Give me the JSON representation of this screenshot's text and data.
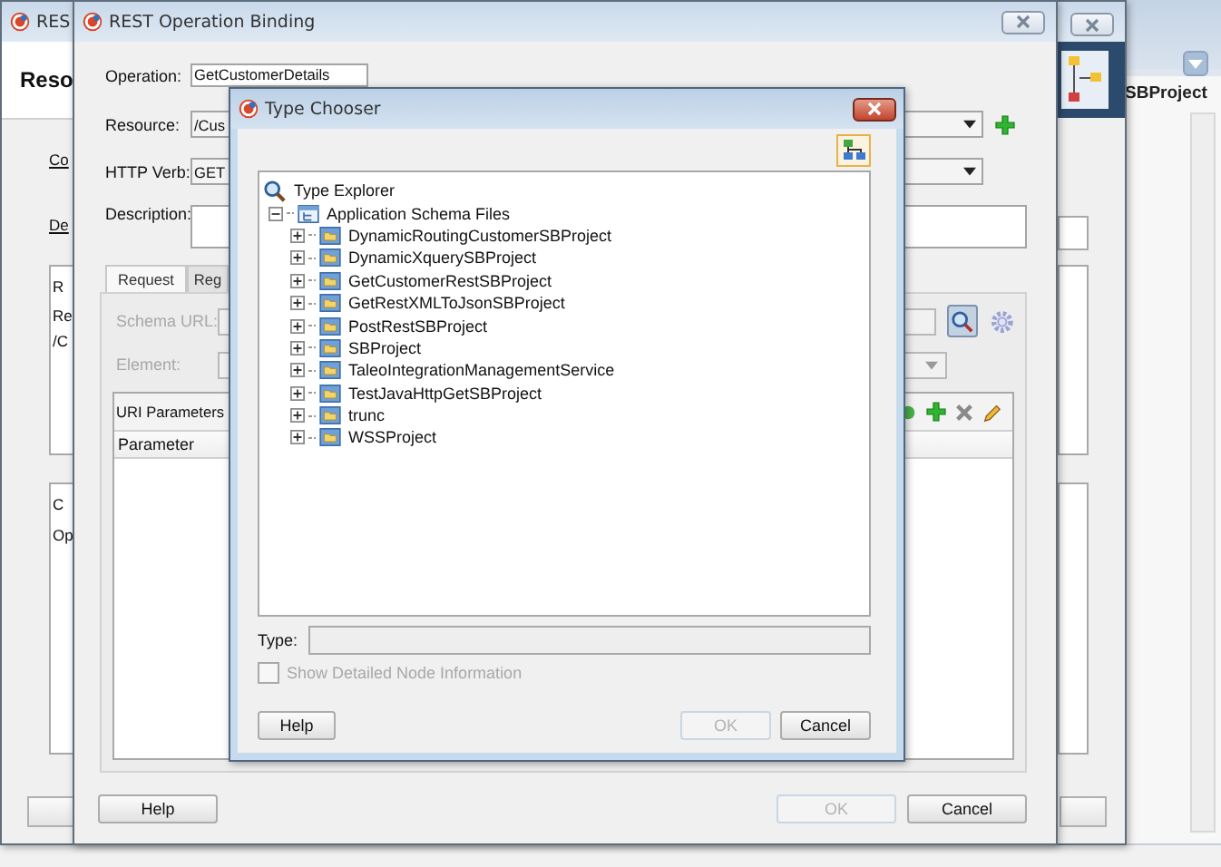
{
  "background_app": {
    "tab_label": "SBProject"
  },
  "back_dialog": {
    "title": "RES",
    "header": "Reso",
    "labels": [
      "Co",
      "De"
    ],
    "panel_top": [
      "R",
      "Re",
      "/C"
    ],
    "panel_bottom": [
      "C",
      "Op"
    ]
  },
  "operation_dialog": {
    "title": "REST Operation Binding",
    "fields": [
      {
        "label": "Operation:",
        "value": "GetCustomerDetails",
        "kind": "text"
      },
      {
        "label": "Resource:",
        "value": "/Cus",
        "kind": "dropdown"
      },
      {
        "label": "HTTP Verb:",
        "value": "GET",
        "kind": "dropdown"
      },
      {
        "label": "Description:",
        "kind": "textarea"
      }
    ],
    "tabs": [
      {
        "label": "Request",
        "selected": true
      },
      {
        "label": "Reg",
        "selected": false
      }
    ],
    "schema_url": {
      "label": "Schema URL:",
      "disabled": true
    },
    "element": {
      "label": "Element:",
      "disabled": true
    },
    "uri_parameters": {
      "title": "URI Parameters",
      "columns": [
        "Parameter"
      ]
    },
    "buttons": [
      {
        "label": "Help",
        "disabled": false
      },
      {
        "label": "OK",
        "disabled": true
      },
      {
        "label": "Cancel",
        "disabled": false
      }
    ]
  },
  "type_chooser": {
    "title": "Type Chooser",
    "tree": {
      "label": "Type Explorer",
      "children": [
        {
          "label": "Application Schema Files",
          "expanded": true,
          "children": [
            {
              "label": "DynamicRoutingCustomerSBProject",
              "expanded": false
            },
            {
              "label": "DynamicXquerySBProject",
              "expanded": false
            },
            {
              "label": "GetCustomerRestSBProject",
              "expanded": false
            },
            {
              "label": "GetRestXMLToJsonSBProject",
              "expanded": false
            },
            {
              "label": "PostRestSBProject",
              "expanded": false
            },
            {
              "label": "SBProject",
              "expanded": false
            },
            {
              "label": "TaleoIntegrationManagementService",
              "expanded": false
            },
            {
              "label": "TestJavaHttpGetSBProject",
              "expanded": false
            },
            {
              "label": "trunc",
              "expanded": false
            },
            {
              "label": "WSSProject",
              "expanded": false
            }
          ]
        }
      ]
    },
    "type_field": {
      "label": "Type:"
    },
    "checkbox": {
      "label": "Show Detailed Node Information",
      "checked": false,
      "disabled": true
    },
    "buttons": [
      {
        "label": "Help",
        "disabled": false
      },
      {
        "label": "OK",
        "disabled": true
      },
      {
        "label": "Cancel",
        "disabled": false
      }
    ]
  }
}
